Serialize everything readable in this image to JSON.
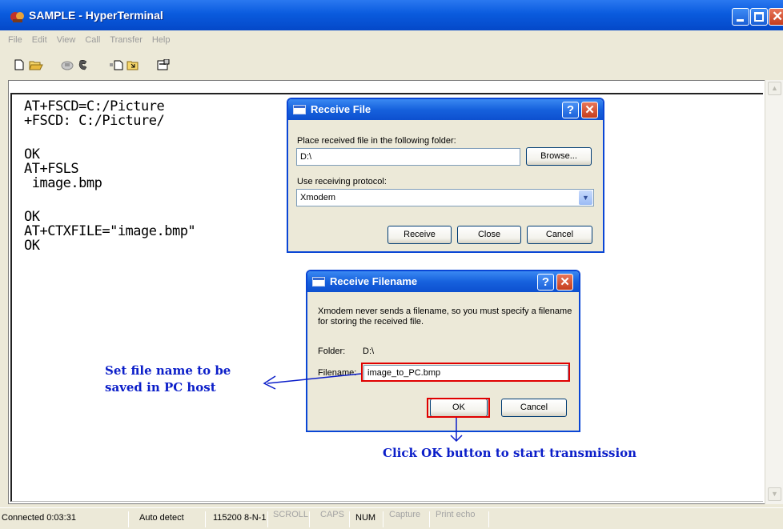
{
  "window": {
    "title": "SAMPLE - HyperTerminal"
  },
  "menu": [
    "File",
    "Edit",
    "View",
    "Call",
    "Transfer",
    "Help"
  ],
  "toolbar": [
    "new-connection-icon",
    "open-icon",
    "disconnect-icon",
    "dial-icon",
    "send-icon",
    "receive-icon",
    "properties-icon"
  ],
  "terminal": {
    "lines": [
      "AT+FSCD=C:/Picture",
      "+FSCD: C:/Picture/",
      "",
      "OK",
      "AT+FSLS",
      " image.bmp",
      "",
      "OK",
      "AT+CTXFILE=\"image.bmp\"",
      "OK"
    ]
  },
  "receive_file": {
    "title": "Receive File",
    "folder_label": "Place received file in the following folder:",
    "folder_value": "D:\\",
    "browse": "Browse...",
    "protocol_label": "Use receiving protocol:",
    "protocol_value": "Xmodem",
    "receive": "Receive",
    "close": "Close",
    "cancel": "Cancel"
  },
  "receive_filename": {
    "title": "Receive Filename",
    "message": "Xmodem never sends a filename, so you must specify a filename for storing the received file.",
    "folder_label": "Folder:",
    "folder_value": "D:\\",
    "filename_label": "Filename:",
    "filename_value": "image_to_PC.bmp",
    "ok": "OK",
    "cancel": "Cancel"
  },
  "annotations": {
    "filename_note_line1": "Set file name to be",
    "filename_note_line2": "saved in PC host",
    "ok_note": "Click OK button to start transmission"
  },
  "statusbar": {
    "connected": "Connected 0:03:31",
    "detect": "Auto detect",
    "settings": "115200 8-N-1",
    "scroll": "SCROLL",
    "caps": "CAPS",
    "num": "NUM",
    "capture": "Capture",
    "print_echo": "Print echo"
  },
  "colors": {
    "titlebar": "#0a5bde",
    "annotation": "#0b1ec9",
    "highlight": "#e00000"
  }
}
